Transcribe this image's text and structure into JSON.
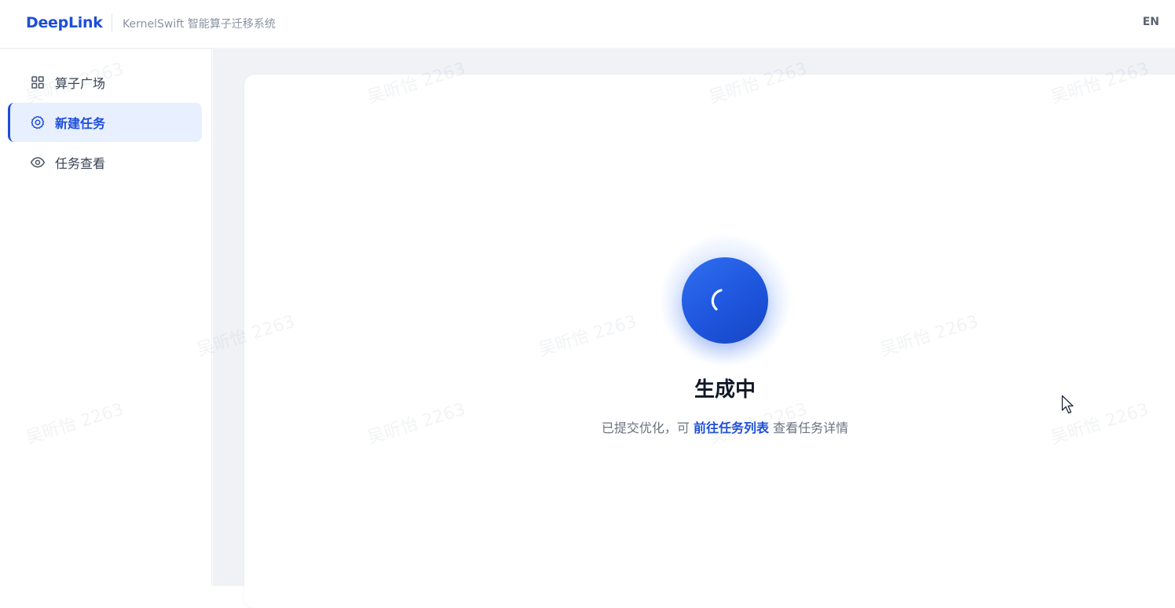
{
  "header": {
    "logo": "DeepLink",
    "subtitle": "KernelSwift 智能算子迁移系统",
    "lang_toggle": "EN"
  },
  "sidebar": {
    "items": [
      {
        "label": "算子广场",
        "icon": "grid-icon",
        "active": false
      },
      {
        "label": "新建任务",
        "icon": "gear-icon",
        "active": true
      },
      {
        "label": "任务查看",
        "icon": "eye-icon",
        "active": false
      }
    ]
  },
  "status": {
    "title": "生成中",
    "desc_prefix": "已提交优化，可",
    "link": "前往任务列表",
    "desc_suffix": "查看任务详情"
  },
  "watermark": "吴昕怡 2263",
  "colors": {
    "accent": "#1d4ed8",
    "spinner": "#1e55dd",
    "content_bg": "#f0f2f6"
  }
}
